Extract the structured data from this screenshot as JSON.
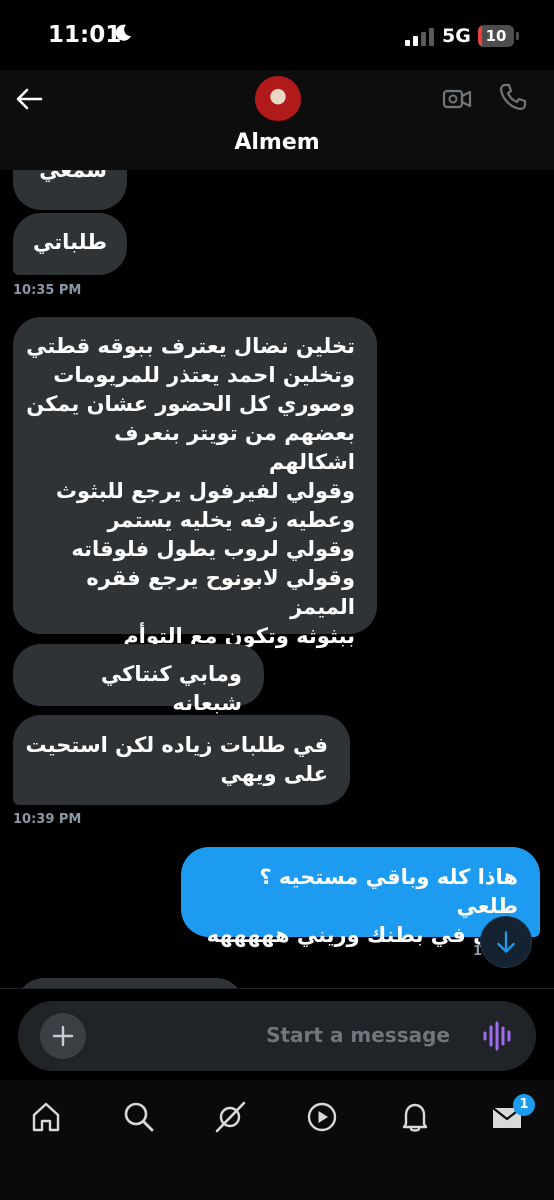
{
  "status_bar": {
    "time": "11:01",
    "network": "5G",
    "battery": "10",
    "battery_level": 0.1
  },
  "header": {
    "contact_name": "Almem"
  },
  "messages": {
    "m0": "سمعي",
    "m1": "طلباتي",
    "t1": "10:35 PM",
    "m2": "تخلين نضال يعترف ببوقه قطتي\nوتخلين احمد يعتذر للمريومات\nوصوري كل الحضور عشان يمكن\nبعضهم من تويتر بنعرف\nاشكالهم\nوقولي لفيرفول يرجع للبثوث\nوعطيه زفه يخليه يستمر\nوقولي لروب يطول فلوقاته\nوقولي لابونوح يرجع فقره الميمز\nببثوثه وتكون مع التوأم",
    "m3": "ومابي كنتاكي شبعانه",
    "m4": "في طلبات زياده لكن استحيت\nعلى ويهي",
    "t2": "10:39 PM",
    "m5": "هاذا كله وباقي مستحيه ؟ طلعي\nاللي في بطنك وريني هههههه",
    "t3": "10"
  },
  "composer": {
    "placeholder": "Start a message"
  },
  "nav": {
    "messages_badge": "1"
  },
  "colors": {
    "incoming": "#2f3336",
    "outgoing": "#1d9bf0",
    "accent": "#1d9bf0",
    "voice": "#a06cf0"
  }
}
